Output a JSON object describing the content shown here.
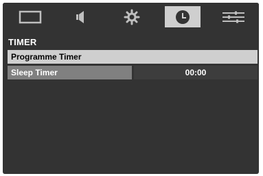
{
  "tabs": [
    {
      "icon": "picture-icon",
      "active": false
    },
    {
      "icon": "sound-icon",
      "active": false
    },
    {
      "icon": "settings-gear-icon",
      "active": false
    },
    {
      "icon": "timer-clock-icon",
      "active": true
    },
    {
      "icon": "options-sliders-icon",
      "active": false
    }
  ],
  "menu": {
    "title": "TIMER",
    "items": [
      {
        "label": "Programme Timer",
        "value": ""
      },
      {
        "label": "Sleep Timer",
        "value": "00:00"
      }
    ]
  },
  "colors": {
    "background": "#333333",
    "highlight": "#cfcfcf",
    "item_left": "#808080",
    "item_right": "#3d3d3d",
    "text": "#ffffff"
  }
}
